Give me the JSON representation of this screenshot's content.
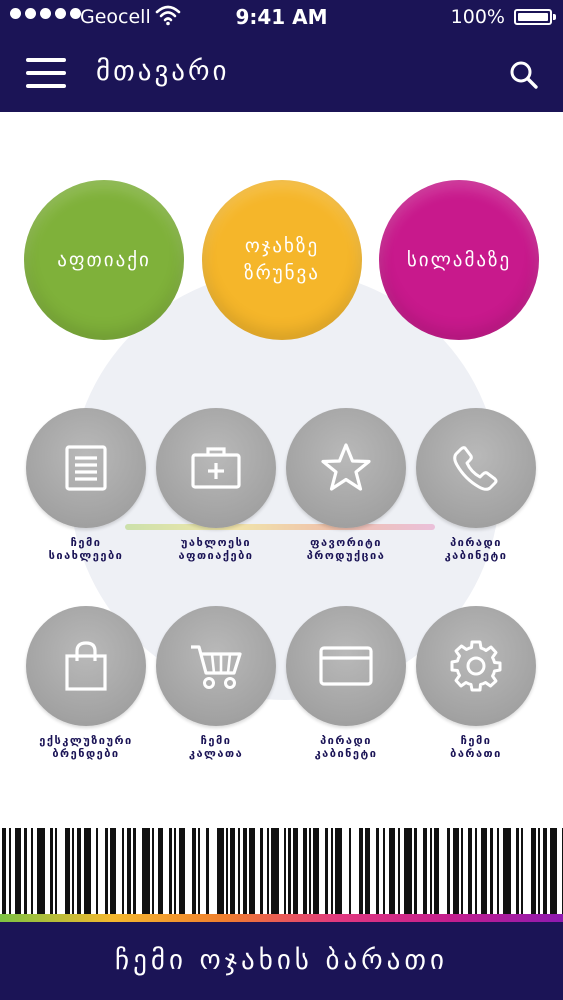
{
  "status_bar": {
    "carrier": "Geocell",
    "time": "9:41 AM",
    "battery": "100%"
  },
  "nav": {
    "title": "მთავარი",
    "menu_icon": "hamburger-menu-icon",
    "search_icon": "search-icon"
  },
  "categories": [
    {
      "label": "აფთიაქი",
      "color": "#7fb13a"
    },
    {
      "label": "ოჯახზე\nზრუნვა",
      "color": "#f5b62a"
    },
    {
      "label": "სილამაზე",
      "color": "#c8198c"
    }
  ],
  "menu_row1": [
    {
      "label": "ჩემი\nსიახლეები",
      "icon": "list-document-icon"
    },
    {
      "label": "უახლოესი\nაფთიაქები",
      "icon": "first-aid-kit-icon"
    },
    {
      "label": "ფავორიტი\nპროდუქცია",
      "icon": "star-icon"
    },
    {
      "label": "პირადი\nკაბინეტი",
      "icon": "phone-icon"
    }
  ],
  "menu_row2": [
    {
      "label": "ექსკლუზიური\nბრენდები",
      "icon": "shopping-bag-icon"
    },
    {
      "label": "ჩემი\nკალათა",
      "icon": "shopping-cart-icon"
    },
    {
      "label": "პირადი\nკაბინეტი",
      "icon": "card-icon"
    },
    {
      "label": "ჩემი\nბარათი",
      "icon": "gear-icon"
    }
  ],
  "footer": {
    "label": "ჩემი ოჯახის ბარათი"
  },
  "colors": {
    "navy": "#1b1456",
    "icon_gray": "#a8a8a8"
  }
}
